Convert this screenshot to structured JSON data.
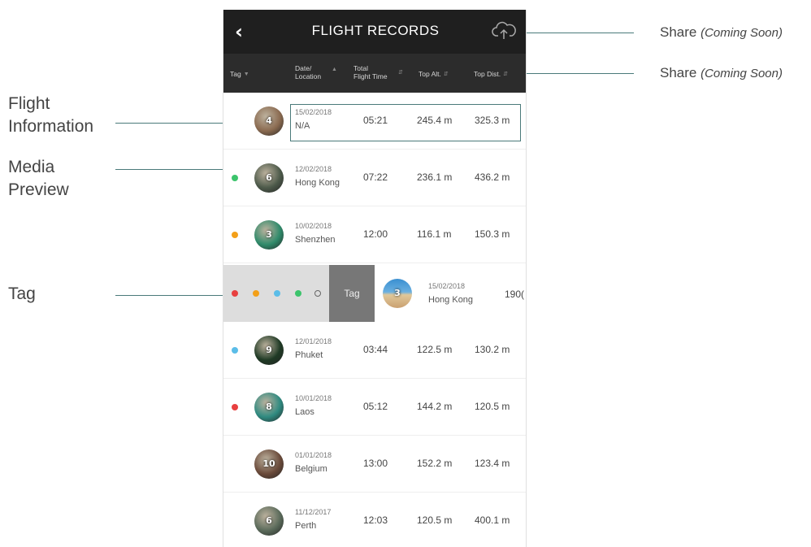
{
  "annotations": {
    "flight_info": [
      "Flight",
      "Information"
    ],
    "media_preview": [
      "Media",
      "Preview"
    ],
    "tag": "Tag",
    "share_1": {
      "label": "Share",
      "note": "(Coming Soon)"
    },
    "share_2": {
      "label": "Share",
      "note": "(Coming Soon)"
    }
  },
  "header": {
    "back_icon": "chevron-left-icon",
    "title": "FLIGHT RECORDS",
    "share_icon": "cloud-upload-icon"
  },
  "columns": {
    "tag": "Tag",
    "date": [
      "Date/",
      "Location"
    ],
    "time": [
      "Total",
      "Flight Time"
    ],
    "alt": "Top Alt.",
    "dist": "Top Dist."
  },
  "rows": [
    {
      "tag": "",
      "tag_color": "",
      "count": "4",
      "date": "15/02/2018",
      "location": "N/A",
      "time": "05:21",
      "alt": "245.4 m",
      "dist": "325.3 m",
      "thumb_color": "#8a6a50"
    },
    {
      "tag": "green",
      "tag_color": "#3cc46c",
      "count": "6",
      "date": "12/02/2018",
      "location": "Hong Kong",
      "time": "07:22",
      "alt": "236.1 m",
      "dist": "436.2 m",
      "thumb_color": "#4d5a4a"
    },
    {
      "tag": "orange",
      "tag_color": "#f3a019",
      "count": "3",
      "date": "10/02/2018",
      "location": "Shenzhen",
      "time": "12:00",
      "alt": "116.1 m",
      "dist": "150.3 m",
      "thumb_color": "#2f8a6a"
    },
    {
      "tag": "blue",
      "tag_color": "#5bbde8",
      "count": "9",
      "date": "12/01/2018",
      "location": "Phuket",
      "time": "03:44",
      "alt": "122.5 m",
      "dist": "130.2 m",
      "thumb_color": "#1f3a25"
    },
    {
      "tag": "red",
      "tag_color": "#e84040",
      "count": "8",
      "date": "10/01/2018",
      "location": "Laos",
      "time": "05:12",
      "alt": "144.2 m",
      "dist": "120.5 m",
      "thumb_color": "#2f8a80"
    },
    {
      "tag": "",
      "tag_color": "",
      "count": "10",
      "date": "01/01/2018",
      "location": "Belgium",
      "time": "13:00",
      "alt": "152.2 m",
      "dist": "123.4 m",
      "thumb_color": "#6a4a3a"
    },
    {
      "tag": "",
      "tag_color": "",
      "count": "6",
      "date": "11/12/2017",
      "location": "Perth",
      "time": "12:03",
      "alt": "120.5 m",
      "dist": "400.1 m",
      "thumb_color": "#5a6a5a"
    }
  ],
  "swipe_row": {
    "tag_colors": [
      "#e84040",
      "#f3a019",
      "#5bbde8",
      "#3cc46c"
    ],
    "tag_button": "Tag",
    "count": "3",
    "date": "15/02/2018",
    "location": "Hong Kong",
    "partial_value": "190(",
    "thumb_color": "#3a8fd0"
  }
}
